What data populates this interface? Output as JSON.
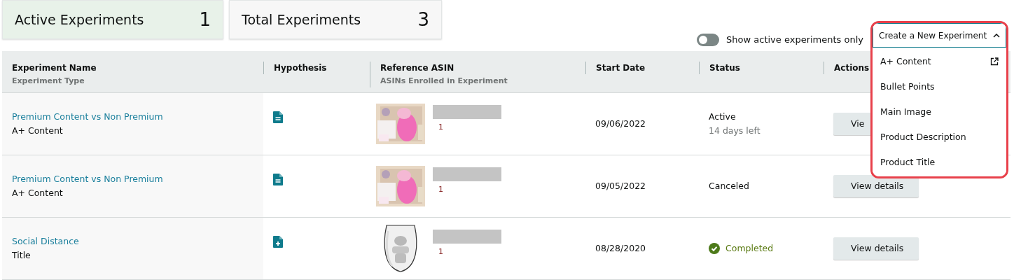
{
  "stats": [
    {
      "label": "Active Experiments",
      "value": "1",
      "selected": true
    },
    {
      "label": "Total Experiments",
      "value": "3",
      "selected": false
    }
  ],
  "toggle": {
    "label": "Show active experiments only",
    "on": false
  },
  "create_menu": {
    "label": "Create a New Experiment",
    "expanded": true,
    "items": [
      {
        "label": "A+ Content",
        "kind": "external"
      },
      {
        "label": "Bullet Points",
        "kind": "plain"
      },
      {
        "label": "Main Image",
        "kind": "plain"
      },
      {
        "label": "Product Description",
        "kind": "plain"
      },
      {
        "label": "Product Title",
        "kind": "plain"
      }
    ]
  },
  "table": {
    "columns": [
      {
        "title": "Experiment Name",
        "subtitle": "Experiment Type"
      },
      {
        "title": "Hypothesis"
      },
      {
        "title": "Reference ASIN",
        "subtitle": "ASINs Enrolled in Experiment"
      },
      {
        "title": "Start Date"
      },
      {
        "title": "Status"
      },
      {
        "title": "Actions"
      }
    ],
    "rows": [
      {
        "name": "Premium Content vs Non Premium",
        "type": "A+ Content",
        "hypothesis": {
          "kind": "document"
        },
        "enrolled": "1",
        "start_date": "09/06/2022",
        "status": {
          "kind": "plain",
          "label": "Active",
          "note": "14 days left"
        },
        "action": "Vie"
      },
      {
        "name": "Premium Content vs Non Premium",
        "type": "A+ Content",
        "hypothesis": {
          "kind": "document"
        },
        "enrolled": "1",
        "start_date": "09/05/2022",
        "status": {
          "kind": "plain",
          "label": "Canceled"
        },
        "action": "View details"
      },
      {
        "name": "Social Distance",
        "type": "Title",
        "hypothesis": {
          "kind": "document-plus"
        },
        "enrolled": "1",
        "start_date": "08/28/2020",
        "status": {
          "kind": "completed",
          "label": "Completed"
        },
        "action": "View details"
      }
    ]
  }
}
